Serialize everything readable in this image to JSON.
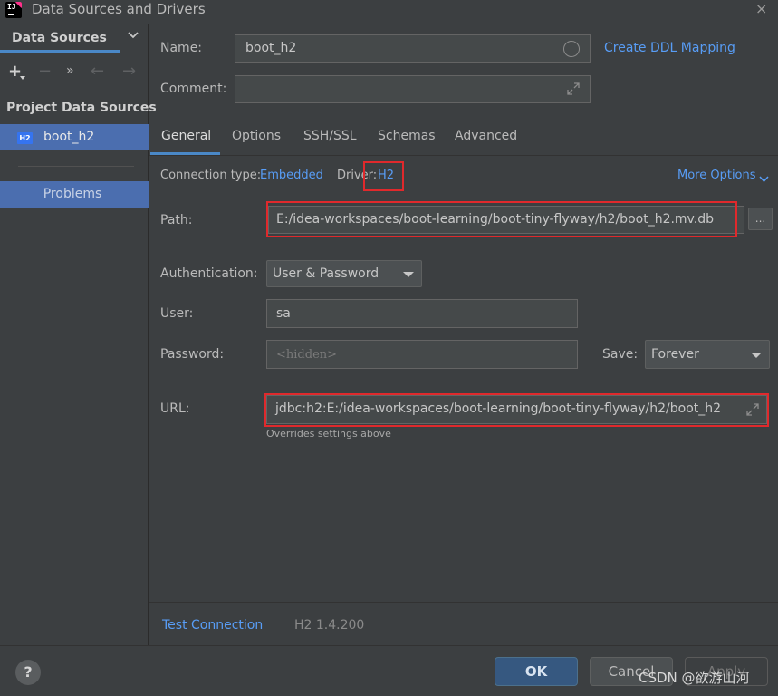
{
  "window": {
    "title": "Data Sources and Drivers",
    "app_icon_text": "IJ",
    "close_glyph": "×"
  },
  "sidebar": {
    "tab_label": "Data Sources",
    "toolbar": {
      "add": "+",
      "remove": "−",
      "more": "»",
      "back": "←",
      "forward": "→"
    },
    "section_title": "Project Data Sources",
    "items": [
      {
        "badge": "H2",
        "label": "boot_h2"
      }
    ],
    "problems_label": "Problems"
  },
  "form": {
    "name_label": "Name:",
    "name_value": "boot_h2",
    "create_ddl_link": "Create DDL Mapping",
    "comment_label": "Comment:",
    "comment_value": ""
  },
  "tabs": [
    {
      "label": "General",
      "active": true
    },
    {
      "label": "Options"
    },
    {
      "label": "SSH/SSL"
    },
    {
      "label": "Schemas"
    },
    {
      "label": "Advanced"
    }
  ],
  "general": {
    "connection_type_label": "Connection type:",
    "connection_type_value": "Embedded",
    "driver_label": "Driver:",
    "driver_value": "H2",
    "more_options": "More Options",
    "path_label": "Path:",
    "path_value": "E:/idea-workspaces/boot-learning/boot-tiny-flyway/h2/boot_h2.mv.db",
    "path_browse": "...",
    "auth_label": "Authentication:",
    "auth_value": "User & Password",
    "user_label": "User:",
    "user_value": "sa",
    "password_label": "Password:",
    "password_placeholder": "<hidden>",
    "save_label": "Save:",
    "save_value": "Forever",
    "url_label": "URL:",
    "url_value": "jdbc:h2:E:/idea-workspaces/boot-learning/boot-tiny-flyway/h2/boot_h2",
    "url_hint": "Overrides settings above"
  },
  "footer": {
    "test_connection": "Test Connection",
    "driver_version": "H2 1.4.200"
  },
  "buttons": {
    "help": "?",
    "ok": "OK",
    "cancel": "Cancel",
    "apply": "Apply"
  },
  "watermark": "CSDN @欲游山河",
  "colors": {
    "background": "#3c3f41",
    "selection": "#4b6eaf",
    "link": "#589df6",
    "highlight_box": "#e0292c"
  }
}
